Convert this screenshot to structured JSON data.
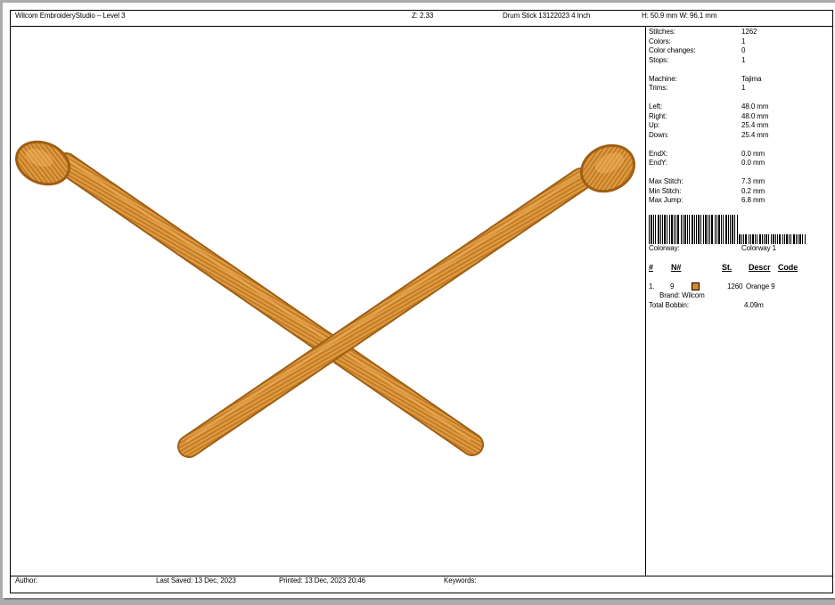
{
  "header": {
    "app_title": "Wilcom EmbroideryStudio – Level 3",
    "zoom": "Z: 2.33",
    "design_name": "Drum Stick 13122023 4 Inch",
    "dimensions": "H: 50.9 mm  W: 96.1 mm"
  },
  "stats": [
    {
      "label": "Stitches:",
      "value": "1262"
    },
    {
      "label": "Colors:",
      "value": "1"
    },
    {
      "label": "Color changes:",
      "value": "0"
    },
    {
      "label": "Stops:",
      "value": "1"
    },
    {
      "label": "Machine:",
      "value": "Tajima"
    },
    {
      "label": "Trims:",
      "value": "1"
    },
    {
      "label": "Left:",
      "value": "48.0 mm"
    },
    {
      "label": "Right:",
      "value": "48.0 mm"
    },
    {
      "label": "Up:",
      "value": "25.4 mm"
    },
    {
      "label": "Down:",
      "value": "25.4 mm"
    },
    {
      "label": "EndX:",
      "value": "0.0 mm"
    },
    {
      "label": "EndY:",
      "value": "0.0 mm"
    },
    {
      "label": "Max Stitch:",
      "value": "7.3 mm"
    },
    {
      "label": "Min Stitch:",
      "value": "0.2 mm"
    },
    {
      "label": "Max Jump:",
      "value": "6.8 mm"
    }
  ],
  "colorway": {
    "label": "Colorway:",
    "value": "Colorway 1"
  },
  "color_table": {
    "headers": {
      "num": "#",
      "needle": "N#",
      "stitches": "St.",
      "descr": "Descr",
      "code": "Code"
    },
    "rows": [
      {
        "num": "1.",
        "needle": "9",
        "swatch_color": "#d9862b",
        "stitches": "1260",
        "descr": "Orange 9",
        "brand": "Brand: Wilcom"
      }
    ]
  },
  "total_bobbin": {
    "label": "Total Bobbin:",
    "value": "4.09m"
  },
  "footer": {
    "author": "Author:",
    "last_saved": "Last Saved: 13 Dec, 2023",
    "printed": "Printed: 13 Dec, 2023 20:46",
    "keywords": "Keywords:"
  },
  "colors": {
    "thread_base": "#d08a32",
    "thread_light": "#f2b561",
    "thread_dark": "#9e5f14"
  }
}
